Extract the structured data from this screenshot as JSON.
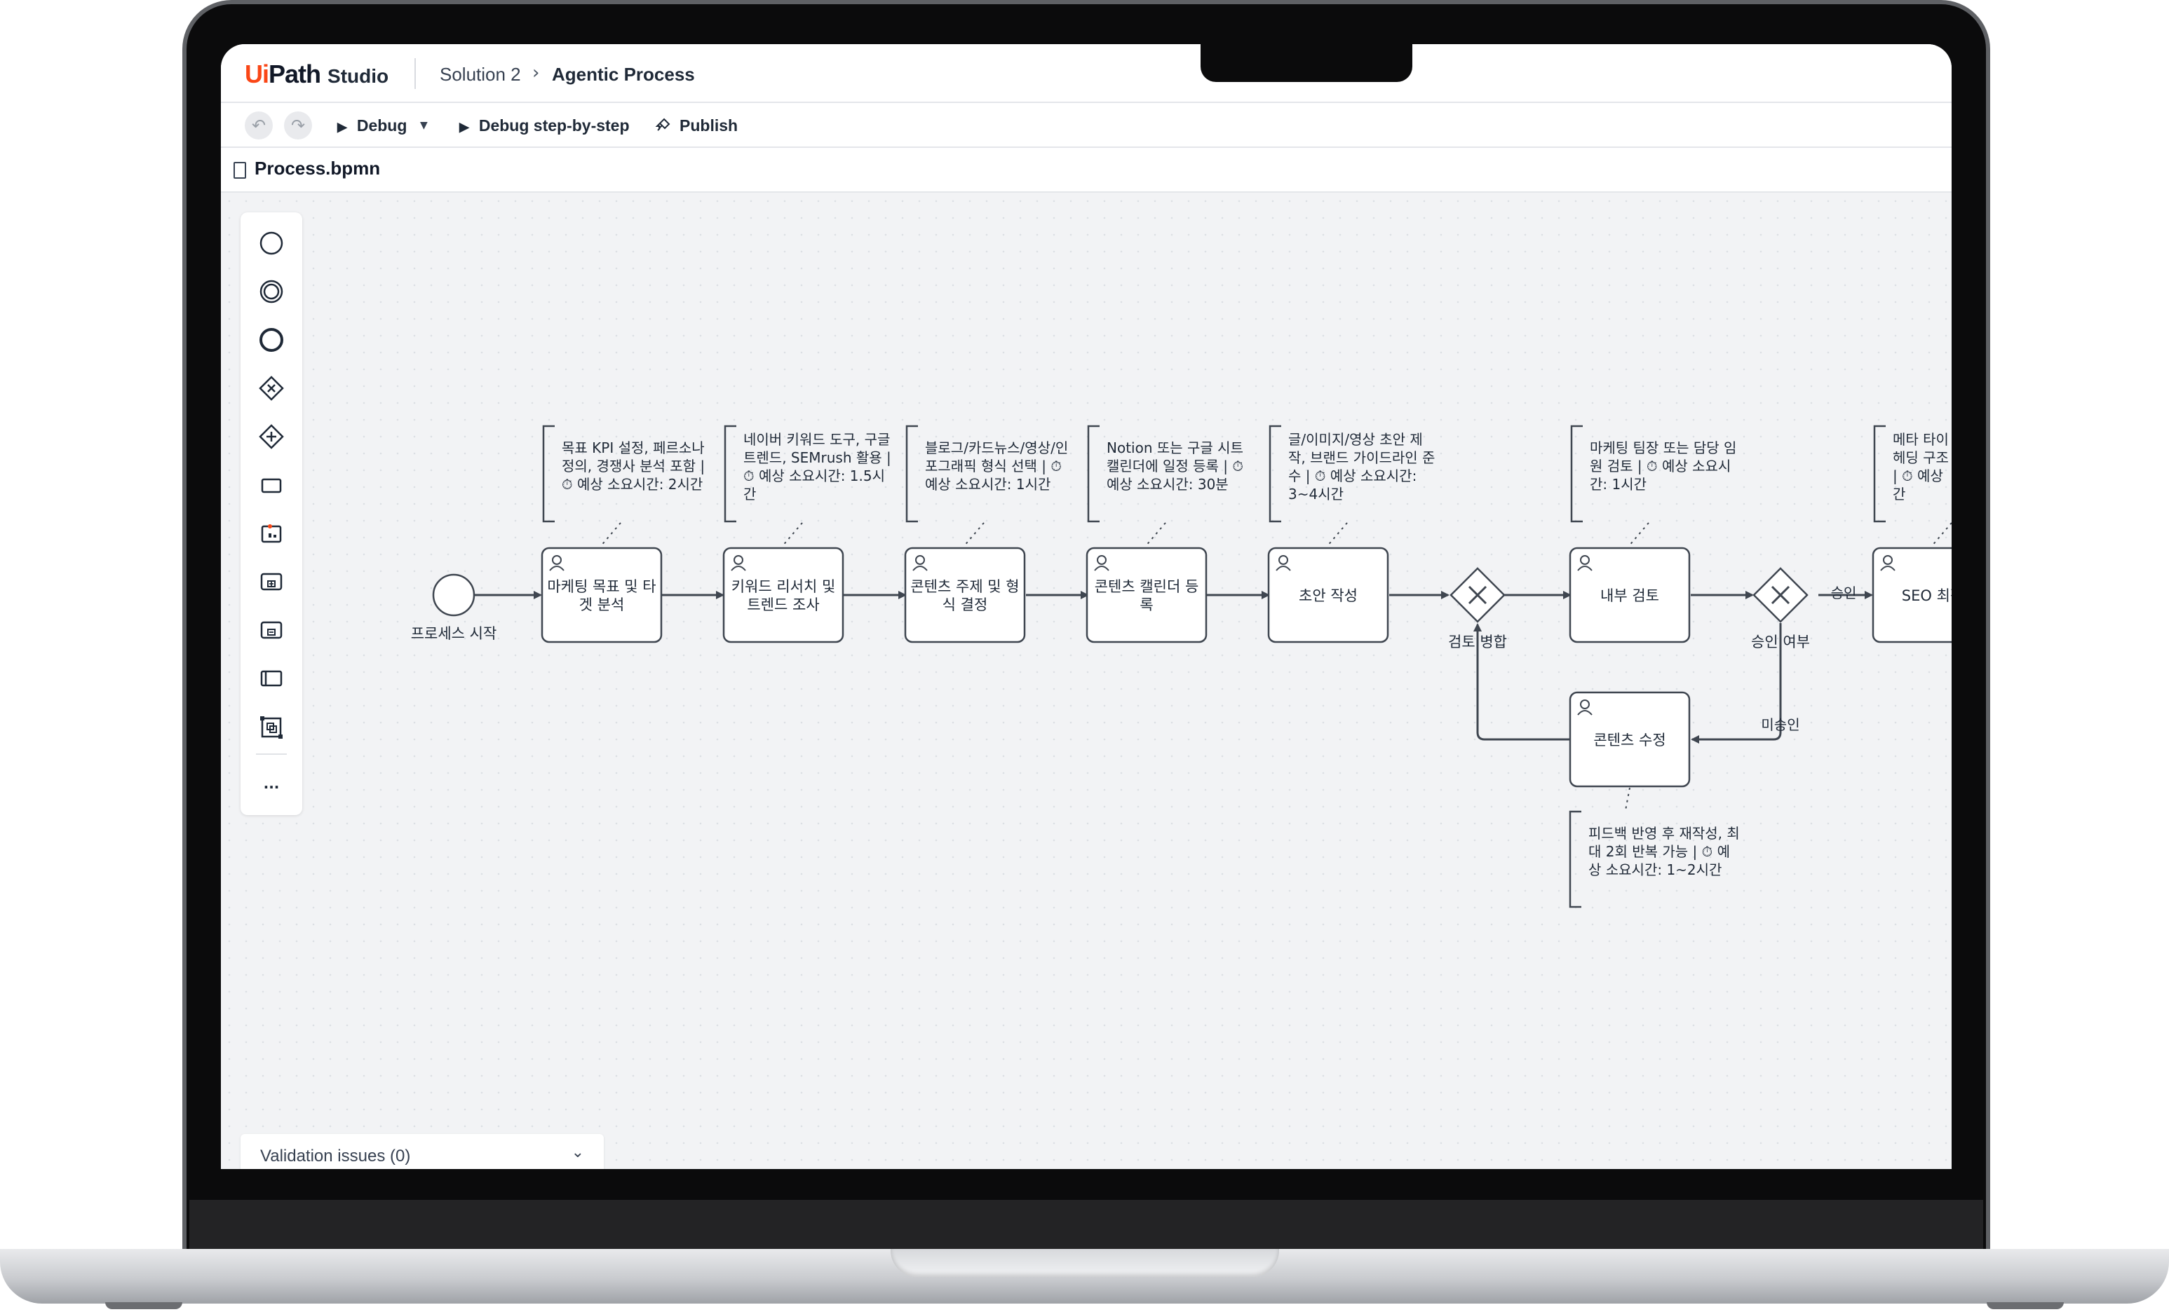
{
  "app": {
    "brand_ui": "Ui",
    "brand_path": "Path",
    "brand_studio": "Studio",
    "breadcrumb": [
      "Solution 2",
      "Agentic Process"
    ]
  },
  "toolbar": {
    "undo_icon": "undo-icon",
    "redo_icon": "redo-icon",
    "debug_label": "Debug",
    "debug_step_label": "Debug step-by-step",
    "publish_label": "Publish"
  },
  "file": {
    "name": "Process.bpmn"
  },
  "palette": {
    "items": [
      "start-event-icon",
      "intermediate-event-icon",
      "end-event-icon",
      "exclusive-gateway-icon",
      "parallel-gateway-icon",
      "task-icon",
      "data-store-icon",
      "subprocess-expanded-icon",
      "subprocess-collapsed-icon",
      "pool-icon",
      "group-icon",
      "more-icon"
    ],
    "more_label": "···"
  },
  "diagram": {
    "start_label": "프로세스 시작",
    "tasks": [
      {
        "lines": [
          "마케팅 목표 및 타",
          "겟 분석"
        ]
      },
      {
        "lines": [
          "키워드 리서치 및",
          "트렌드 조사"
        ]
      },
      {
        "lines": [
          "콘텐츠 주제 및 형",
          "식 결정"
        ]
      },
      {
        "lines": [
          "콘텐츠 캘린더 등",
          "록"
        ]
      },
      {
        "lines": [
          "초안 작성"
        ]
      },
      {
        "lines": [
          "내부 검토"
        ]
      },
      {
        "lines": [
          "SEO 최적"
        ]
      },
      {
        "lines": [
          "콘텐츠 수정"
        ]
      }
    ],
    "annotations": [
      {
        "lines": [
          "목표 KPI 설정, 페르소나",
          "정의, 경쟁사 분석 포함 |",
          "⏱ 예상 소요시간: 2시간"
        ]
      },
      {
        "lines": [
          "네이버 키워드 도구, 구글",
          "트렌드, SEMrush 활용 |",
          "⏱ 예상 소요시간: 1.5시",
          "간"
        ]
      },
      {
        "lines": [
          "블로그/카드뉴스/영상/인",
          "포그래픽 형식 선택 | ⏱",
          "예상 소요시간: 1시간"
        ]
      },
      {
        "lines": [
          "Notion 또는 구글 시트",
          "캘린더에 일정 등록 | ⏱",
          "예상 소요시간: 30분"
        ]
      },
      {
        "lines": [
          "글/이미지/영상 초안 제",
          "작, 브랜드 가이드라인 준",
          "수 | ⏱ 예상 소요시간:",
          "3~4시간"
        ]
      },
      {
        "lines": [
          "마케팅 팀장 또는 담당 임",
          "원 검토 | ⏱ 예상 소요시",
          "간: 1시간"
        ]
      },
      {
        "lines": [
          "메타 타이",
          "헤딩 구조",
          "| ⏱ 예상",
          "간"
        ]
      },
      {
        "lines": [
          "피드백 반영 후 재작성, 최",
          "대 2회 반복 가능 | ⏱ 예",
          "상 소요시간: 1~2시간"
        ]
      }
    ],
    "gateways": [
      "검토 병합",
      "승인 여부"
    ],
    "flow_labels": {
      "approved": "승인",
      "rejected": "미승인"
    }
  },
  "validation": {
    "label": "Validation issues (0)"
  }
}
